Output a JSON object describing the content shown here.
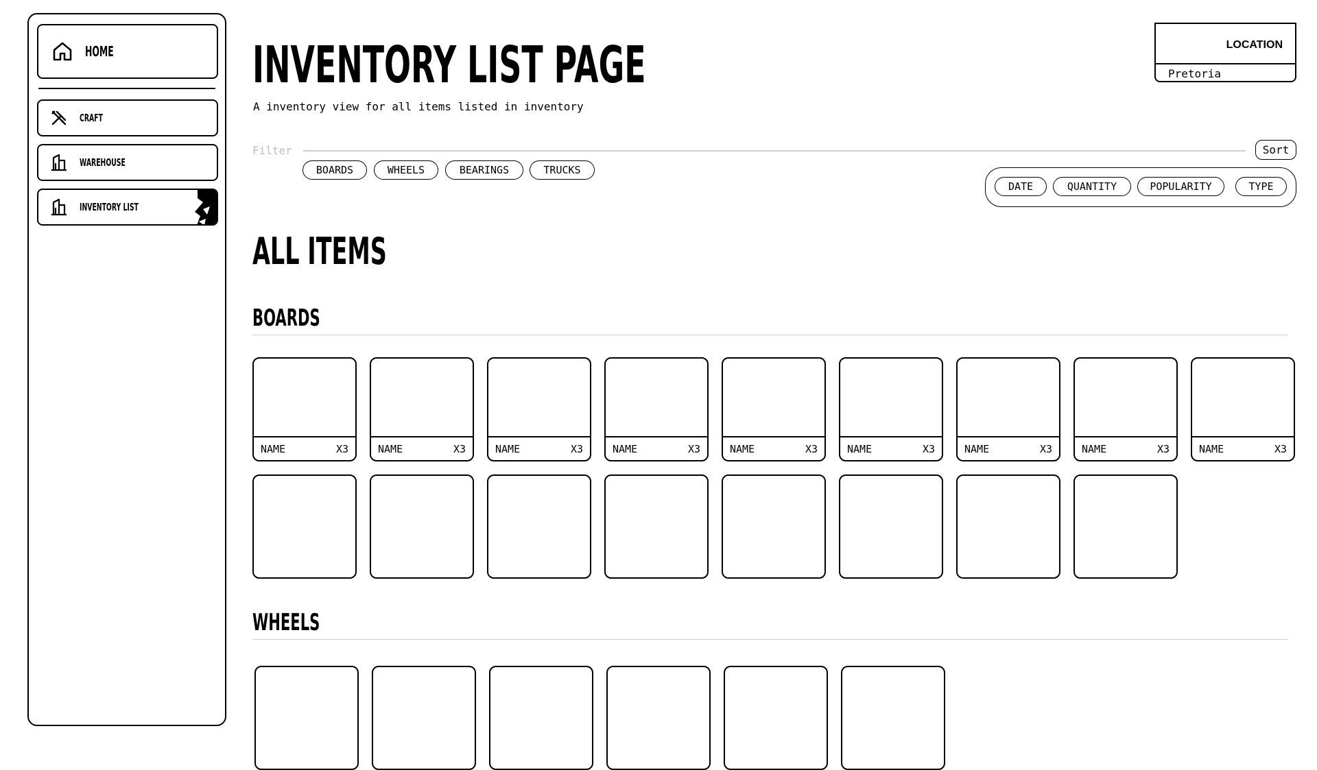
{
  "sidebar": {
    "items": [
      {
        "label": "HOME",
        "icon": "home-icon"
      },
      {
        "label": "CRAFT",
        "icon": "tools-icon"
      },
      {
        "label": "WAREHOUSE",
        "icon": "building-icon"
      },
      {
        "label": "INVENTORY LIST",
        "icon": "building-icon",
        "active": true
      }
    ]
  },
  "header": {
    "title": "INVENTORY LIST PAGE",
    "subtitle": "A inventory view for all items listed in inventory"
  },
  "location": {
    "label": "LOCATION",
    "value": "Pretoria"
  },
  "filter": {
    "label": "Filter",
    "chips": [
      "BOARDS",
      "WHEELS",
      "BEARINGS",
      "TRUCKS"
    ]
  },
  "sort": {
    "button_label": "Sort",
    "options": [
      "DATE",
      "QUANTITY",
      "POPULARITY",
      "TYPE"
    ]
  },
  "main": {
    "all_items_title": "ALL ITEMS",
    "sections": [
      {
        "title": "BOARDS",
        "rows": [
          [
            {
              "name": "NAME",
              "qty": "X3"
            },
            {
              "name": "NAME",
              "qty": "X3"
            },
            {
              "name": "NAME",
              "qty": "X3"
            },
            {
              "name": "NAME",
              "qty": "X3"
            },
            {
              "name": "NAME",
              "qty": "X3"
            },
            {
              "name": "NAME",
              "qty": "X3"
            },
            {
              "name": "NAME",
              "qty": "X3"
            },
            {
              "name": "NAME",
              "qty": "X3"
            },
            {
              "name": "NAME",
              "qty": "X3"
            }
          ],
          [
            {
              "name": "",
              "qty": ""
            },
            {
              "name": "",
              "qty": ""
            },
            {
              "name": "",
              "qty": ""
            },
            {
              "name": "",
              "qty": ""
            },
            {
              "name": "",
              "qty": ""
            },
            {
              "name": "",
              "qty": ""
            },
            {
              "name": "",
              "qty": ""
            },
            {
              "name": "",
              "qty": ""
            }
          ]
        ]
      },
      {
        "title": "WHEELS",
        "rows": [
          [
            {
              "name": "",
              "qty": ""
            },
            {
              "name": "",
              "qty": ""
            },
            {
              "name": "",
              "qty": ""
            },
            {
              "name": "",
              "qty": ""
            },
            {
              "name": "",
              "qty": ""
            },
            {
              "name": "",
              "qty": ""
            }
          ]
        ]
      }
    ]
  }
}
